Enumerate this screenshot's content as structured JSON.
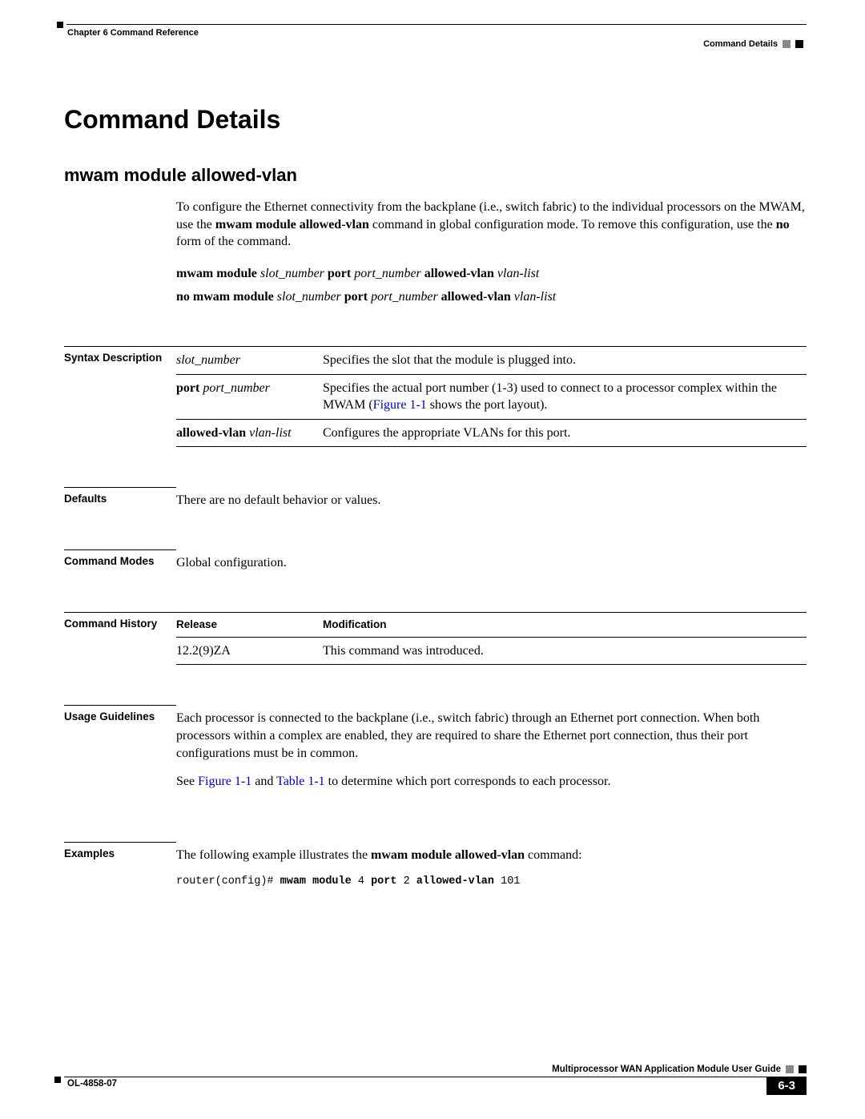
{
  "header": {
    "chapter_line": "Chapter 6      Command Reference",
    "section_name": "Command Details"
  },
  "title": "Command Details",
  "command_name": "mwam module allowed-vlan",
  "intro": {
    "text1": "To configure the Ethernet connectivity from the backplane (i.e., switch fabric) to the individual processors on the MWAM, use the ",
    "bold1": "mwam module allowed-vlan",
    "text2": " command in global configuration mode. To remove this configuration, use the ",
    "bold2": "no",
    "text3": " form of the command."
  },
  "syntax1": {
    "p1": "mwam module ",
    "i1": "slot_number",
    "p2": " port ",
    "i2": "port_number",
    "p3": " allowed-vlan ",
    "i3": "vlan-list"
  },
  "syntax2": {
    "p1": "no mwam module ",
    "i1": "slot_number",
    "p2": " port ",
    "i2": "port_number",
    "p3": " allowed-vlan ",
    "i3": "vlan-list"
  },
  "sections": {
    "syntax_desc": {
      "label": "Syntax Description",
      "rows": [
        {
          "keyword_italic": "slot_number",
          "desc": "Specifies the slot that the module is plugged into."
        },
        {
          "keyword_bold": "port",
          "keyword_italic": " port_number",
          "desc_pre": "Specifies the actual port number (1-3) used to connect to a processor complex within the MWAM (",
          "link": "Figure 1-1",
          "desc_post": " shows the port layout)."
        },
        {
          "keyword_bold": "allowed-vlan",
          "keyword_italic": " vlan-list",
          "desc": "Configures the appropriate VLANs for this port."
        }
      ]
    },
    "defaults": {
      "label": "Defaults",
      "text": "There are no default behavior or values."
    },
    "modes": {
      "label": "Command Modes",
      "text": "Global configuration."
    },
    "history": {
      "label": "Command History",
      "header_release": "Release",
      "header_mod": "Modification",
      "rows": [
        {
          "release": "12.2(9)ZA",
          "mod": "This command was introduced."
        }
      ]
    },
    "usage": {
      "label": "Usage Guidelines",
      "p1": "Each processor is connected to the backplane (i.e., switch fabric) through an Ethernet port connection. When both processors within a complex are enabled, they are required to share the Ethernet port connection, thus their port configurations must be in common.",
      "p2_pre": "See ",
      "link1": "Figure 1-1",
      "p2_mid": " and ",
      "link2": "Table 1-1",
      "p2_post": " to determine which port corresponds to each processor."
    },
    "examples": {
      "label": "Examples",
      "intro_pre": "The following example illustrates the ",
      "intro_bold": "mwam module allowed-vlan",
      "intro_post": " command:",
      "code_prompt": "router(config)# ",
      "code_b1": "mwam module",
      "code_v1": " 4 ",
      "code_b2": "port",
      "code_v2": " 2 ",
      "code_b3": "allowed-vlan",
      "code_v3": " 101"
    }
  },
  "footer": {
    "guide_title": "Multiprocessor WAN Application Module User Guide",
    "doc_id": "OL-4858-07",
    "page_num": "6-3"
  }
}
